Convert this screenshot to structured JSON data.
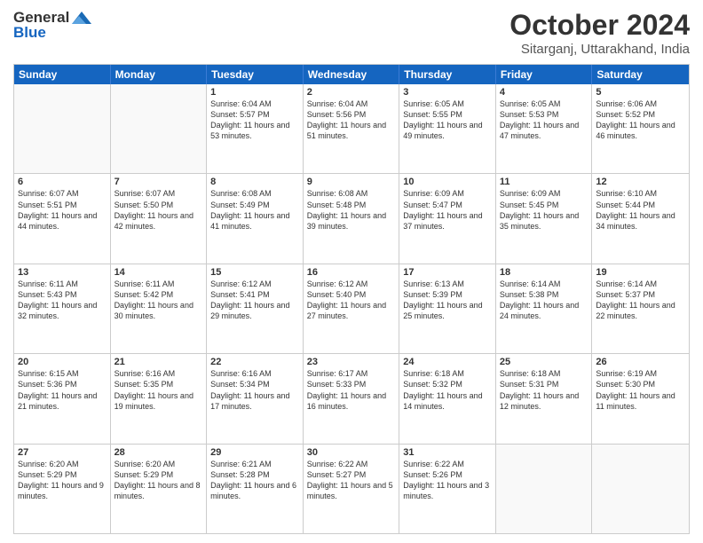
{
  "header": {
    "logo_general": "General",
    "logo_blue": "Blue",
    "month": "October 2024",
    "location": "Sitarganj, Uttarakhand, India"
  },
  "days_of_week": [
    "Sunday",
    "Monday",
    "Tuesday",
    "Wednesday",
    "Thursday",
    "Friday",
    "Saturday"
  ],
  "weeks": [
    [
      {
        "day": "",
        "empty": true
      },
      {
        "day": "",
        "empty": true
      },
      {
        "day": "1",
        "sunrise": "Sunrise: 6:04 AM",
        "sunset": "Sunset: 5:57 PM",
        "daylight": "Daylight: 11 hours and 53 minutes."
      },
      {
        "day": "2",
        "sunrise": "Sunrise: 6:04 AM",
        "sunset": "Sunset: 5:56 PM",
        "daylight": "Daylight: 11 hours and 51 minutes."
      },
      {
        "day": "3",
        "sunrise": "Sunrise: 6:05 AM",
        "sunset": "Sunset: 5:55 PM",
        "daylight": "Daylight: 11 hours and 49 minutes."
      },
      {
        "day": "4",
        "sunrise": "Sunrise: 6:05 AM",
        "sunset": "Sunset: 5:53 PM",
        "daylight": "Daylight: 11 hours and 47 minutes."
      },
      {
        "day": "5",
        "sunrise": "Sunrise: 6:06 AM",
        "sunset": "Sunset: 5:52 PM",
        "daylight": "Daylight: 11 hours and 46 minutes."
      }
    ],
    [
      {
        "day": "6",
        "sunrise": "Sunrise: 6:07 AM",
        "sunset": "Sunset: 5:51 PM",
        "daylight": "Daylight: 11 hours and 44 minutes."
      },
      {
        "day": "7",
        "sunrise": "Sunrise: 6:07 AM",
        "sunset": "Sunset: 5:50 PM",
        "daylight": "Daylight: 11 hours and 42 minutes."
      },
      {
        "day": "8",
        "sunrise": "Sunrise: 6:08 AM",
        "sunset": "Sunset: 5:49 PM",
        "daylight": "Daylight: 11 hours and 41 minutes."
      },
      {
        "day": "9",
        "sunrise": "Sunrise: 6:08 AM",
        "sunset": "Sunset: 5:48 PM",
        "daylight": "Daylight: 11 hours and 39 minutes."
      },
      {
        "day": "10",
        "sunrise": "Sunrise: 6:09 AM",
        "sunset": "Sunset: 5:47 PM",
        "daylight": "Daylight: 11 hours and 37 minutes."
      },
      {
        "day": "11",
        "sunrise": "Sunrise: 6:09 AM",
        "sunset": "Sunset: 5:45 PM",
        "daylight": "Daylight: 11 hours and 35 minutes."
      },
      {
        "day": "12",
        "sunrise": "Sunrise: 6:10 AM",
        "sunset": "Sunset: 5:44 PM",
        "daylight": "Daylight: 11 hours and 34 minutes."
      }
    ],
    [
      {
        "day": "13",
        "sunrise": "Sunrise: 6:11 AM",
        "sunset": "Sunset: 5:43 PM",
        "daylight": "Daylight: 11 hours and 32 minutes."
      },
      {
        "day": "14",
        "sunrise": "Sunrise: 6:11 AM",
        "sunset": "Sunset: 5:42 PM",
        "daylight": "Daylight: 11 hours and 30 minutes."
      },
      {
        "day": "15",
        "sunrise": "Sunrise: 6:12 AM",
        "sunset": "Sunset: 5:41 PM",
        "daylight": "Daylight: 11 hours and 29 minutes."
      },
      {
        "day": "16",
        "sunrise": "Sunrise: 6:12 AM",
        "sunset": "Sunset: 5:40 PM",
        "daylight": "Daylight: 11 hours and 27 minutes."
      },
      {
        "day": "17",
        "sunrise": "Sunrise: 6:13 AM",
        "sunset": "Sunset: 5:39 PM",
        "daylight": "Daylight: 11 hours and 25 minutes."
      },
      {
        "day": "18",
        "sunrise": "Sunrise: 6:14 AM",
        "sunset": "Sunset: 5:38 PM",
        "daylight": "Daylight: 11 hours and 24 minutes."
      },
      {
        "day": "19",
        "sunrise": "Sunrise: 6:14 AM",
        "sunset": "Sunset: 5:37 PM",
        "daylight": "Daylight: 11 hours and 22 minutes."
      }
    ],
    [
      {
        "day": "20",
        "sunrise": "Sunrise: 6:15 AM",
        "sunset": "Sunset: 5:36 PM",
        "daylight": "Daylight: 11 hours and 21 minutes."
      },
      {
        "day": "21",
        "sunrise": "Sunrise: 6:16 AM",
        "sunset": "Sunset: 5:35 PM",
        "daylight": "Daylight: 11 hours and 19 minutes."
      },
      {
        "day": "22",
        "sunrise": "Sunrise: 6:16 AM",
        "sunset": "Sunset: 5:34 PM",
        "daylight": "Daylight: 11 hours and 17 minutes."
      },
      {
        "day": "23",
        "sunrise": "Sunrise: 6:17 AM",
        "sunset": "Sunset: 5:33 PM",
        "daylight": "Daylight: 11 hours and 16 minutes."
      },
      {
        "day": "24",
        "sunrise": "Sunrise: 6:18 AM",
        "sunset": "Sunset: 5:32 PM",
        "daylight": "Daylight: 11 hours and 14 minutes."
      },
      {
        "day": "25",
        "sunrise": "Sunrise: 6:18 AM",
        "sunset": "Sunset: 5:31 PM",
        "daylight": "Daylight: 11 hours and 12 minutes."
      },
      {
        "day": "26",
        "sunrise": "Sunrise: 6:19 AM",
        "sunset": "Sunset: 5:30 PM",
        "daylight": "Daylight: 11 hours and 11 minutes."
      }
    ],
    [
      {
        "day": "27",
        "sunrise": "Sunrise: 6:20 AM",
        "sunset": "Sunset: 5:29 PM",
        "daylight": "Daylight: 11 hours and 9 minutes."
      },
      {
        "day": "28",
        "sunrise": "Sunrise: 6:20 AM",
        "sunset": "Sunset: 5:29 PM",
        "daylight": "Daylight: 11 hours and 8 minutes."
      },
      {
        "day": "29",
        "sunrise": "Sunrise: 6:21 AM",
        "sunset": "Sunset: 5:28 PM",
        "daylight": "Daylight: 11 hours and 6 minutes."
      },
      {
        "day": "30",
        "sunrise": "Sunrise: 6:22 AM",
        "sunset": "Sunset: 5:27 PM",
        "daylight": "Daylight: 11 hours and 5 minutes."
      },
      {
        "day": "31",
        "sunrise": "Sunrise: 6:22 AM",
        "sunset": "Sunset: 5:26 PM",
        "daylight": "Daylight: 11 hours and 3 minutes."
      },
      {
        "day": "",
        "empty": true
      },
      {
        "day": "",
        "empty": true
      }
    ]
  ]
}
